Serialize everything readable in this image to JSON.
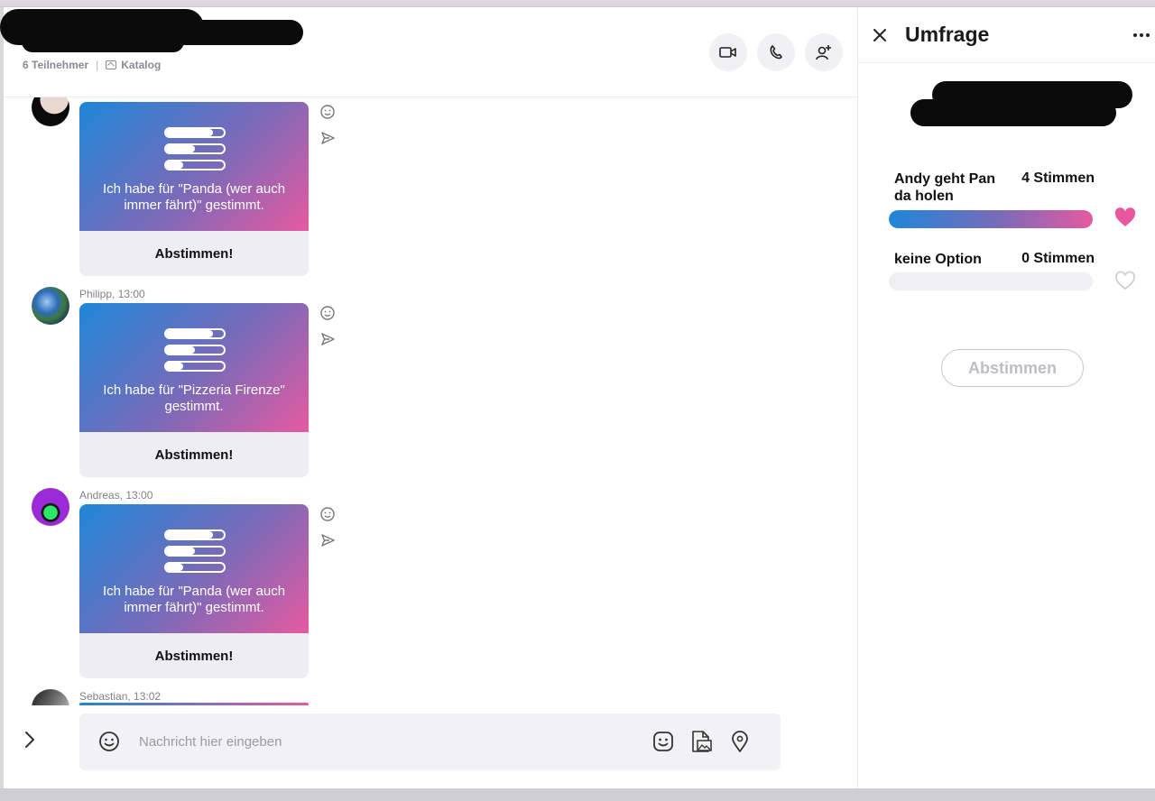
{
  "chat": {
    "participants_count": "6 Teilnehmer",
    "separator": "|",
    "catalog_label": "Katalog",
    "messages": [
      {
        "meta": "",
        "poll_text": "Ich habe für \"Panda (wer auch immer fährt)\" gestimmt.",
        "vote_label": "Abstimmen!"
      },
      {
        "meta": "Philipp, 13:00",
        "poll_text": "Ich habe für \"Pizzeria Firenze\" gestimmt.",
        "vote_label": "Abstimmen!"
      },
      {
        "meta": "Andreas, 13:00",
        "poll_text": "Ich habe für \"Panda (wer auch immer fährt)\" gestimmt.",
        "vote_label": "Abstimmen!"
      },
      {
        "meta": "Sebastian, 13:02"
      }
    ],
    "composer": {
      "placeholder": "Nachricht hier eingeben"
    }
  },
  "panel": {
    "title": "Umfrage",
    "options": [
      {
        "label": "Andy geht Pan da holen",
        "votes": "4 Stimmen",
        "fill_percent": 100,
        "liked": true
      },
      {
        "label": "keine Option",
        "votes": "0 Stimmen",
        "fill_percent": 0,
        "liked": false
      }
    ],
    "vote_button": "Abstimmen"
  },
  "colors": {
    "gradient_start": "#1f86d8",
    "gradient_end": "#e65aa0",
    "heart_active": "#e8589f",
    "heart_inactive": "#cfcfd5"
  },
  "icons": {
    "header": [
      "video-call-icon",
      "phone-icon",
      "add-person-icon"
    ],
    "panel": [
      "close-icon",
      "more-icon"
    ],
    "composer": [
      "emoji-icon",
      "sticker-icon",
      "image-icon",
      "location-icon"
    ]
  }
}
